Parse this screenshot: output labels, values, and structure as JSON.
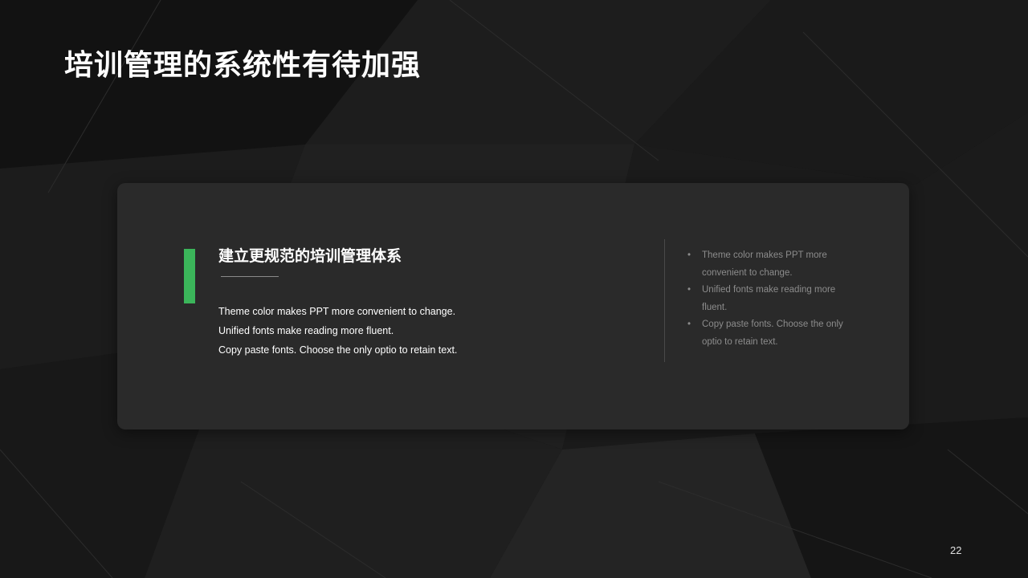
{
  "slide": {
    "title": "培训管理的系统性有待加强",
    "page_number": "22"
  },
  "card": {
    "heading": "建立更规范的培训管理体系",
    "body_lines": [
      "Theme  color makes PPT more convenient  to change.",
      "Unified  fonts make reading more fluent.",
      "Copy paste fonts. Choose  the only  optio to retain text."
    ],
    "bullets": [
      "Theme color makes PPT more convenient to change.",
      "Unified fonts make reading more fluent.",
      "Copy paste fonts. Choose the only optio to retain text."
    ],
    "bullet_symbol": "•"
  },
  "colors": {
    "accent": "#3bb55a",
    "card_background": "#2a2a2a",
    "page_background": "#161616",
    "muted_text": "#8c8c8c"
  }
}
